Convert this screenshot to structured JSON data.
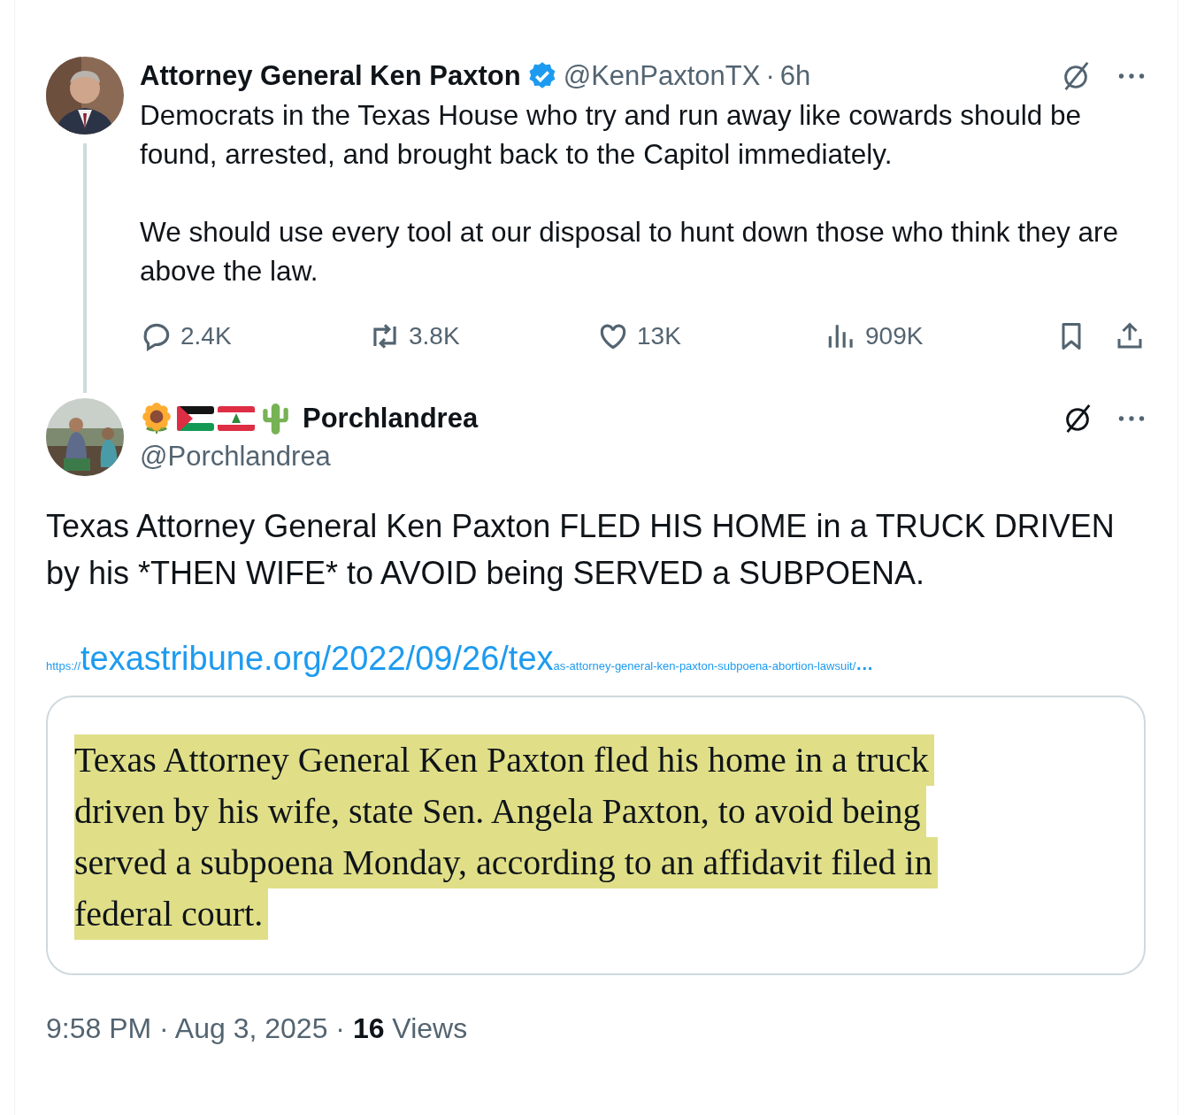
{
  "parent_post": {
    "author": {
      "name": "Attorney General Ken Paxton",
      "verified": true,
      "handle": "@KenPaxtonTX",
      "separator": "·",
      "time": "6h"
    },
    "paragraphs": [
      "Democrats in the Texas House who try and run away like cowards should be found, arrested, and brought back to the Capitol immediately.",
      "We should use every tool at our disposal to hunt down those who think they are above the law."
    ],
    "stats": [
      {
        "kind": "reply",
        "count": "2.4K"
      },
      {
        "kind": "repost",
        "count": "3.8K"
      },
      {
        "kind": "like",
        "count": "13K"
      },
      {
        "kind": "views",
        "count": "909K"
      }
    ]
  },
  "post": {
    "author": {
      "name": "Porchlandrea",
      "handle": "@Porchlandrea"
    },
    "text": "Texas Attorney General Ken Paxton FLED HIS HOME in a TRUCK DRIVEN by his *THEN WIFE* to AVOID being SERVED a SUBPOENA.",
    "link": {
      "prefix": "https://",
      "main": "texastribune.org/2022/09/26/tex",
      "rest": "as-attorney-general-ken-paxton-subpoena-abortion-lawsuit/",
      "ellipsis": "…"
    },
    "quote_image_lines": [
      "Texas Attorney General Ken Paxton fled his home in a truck",
      "driven by his wife, state Sen. Angela Paxton, to avoid being",
      "served a subpoena Monday, according to an affidavit filed in",
      "federal court."
    ],
    "footer": "9:58 PM · Aug 3, 2025 · **16** Views"
  }
}
